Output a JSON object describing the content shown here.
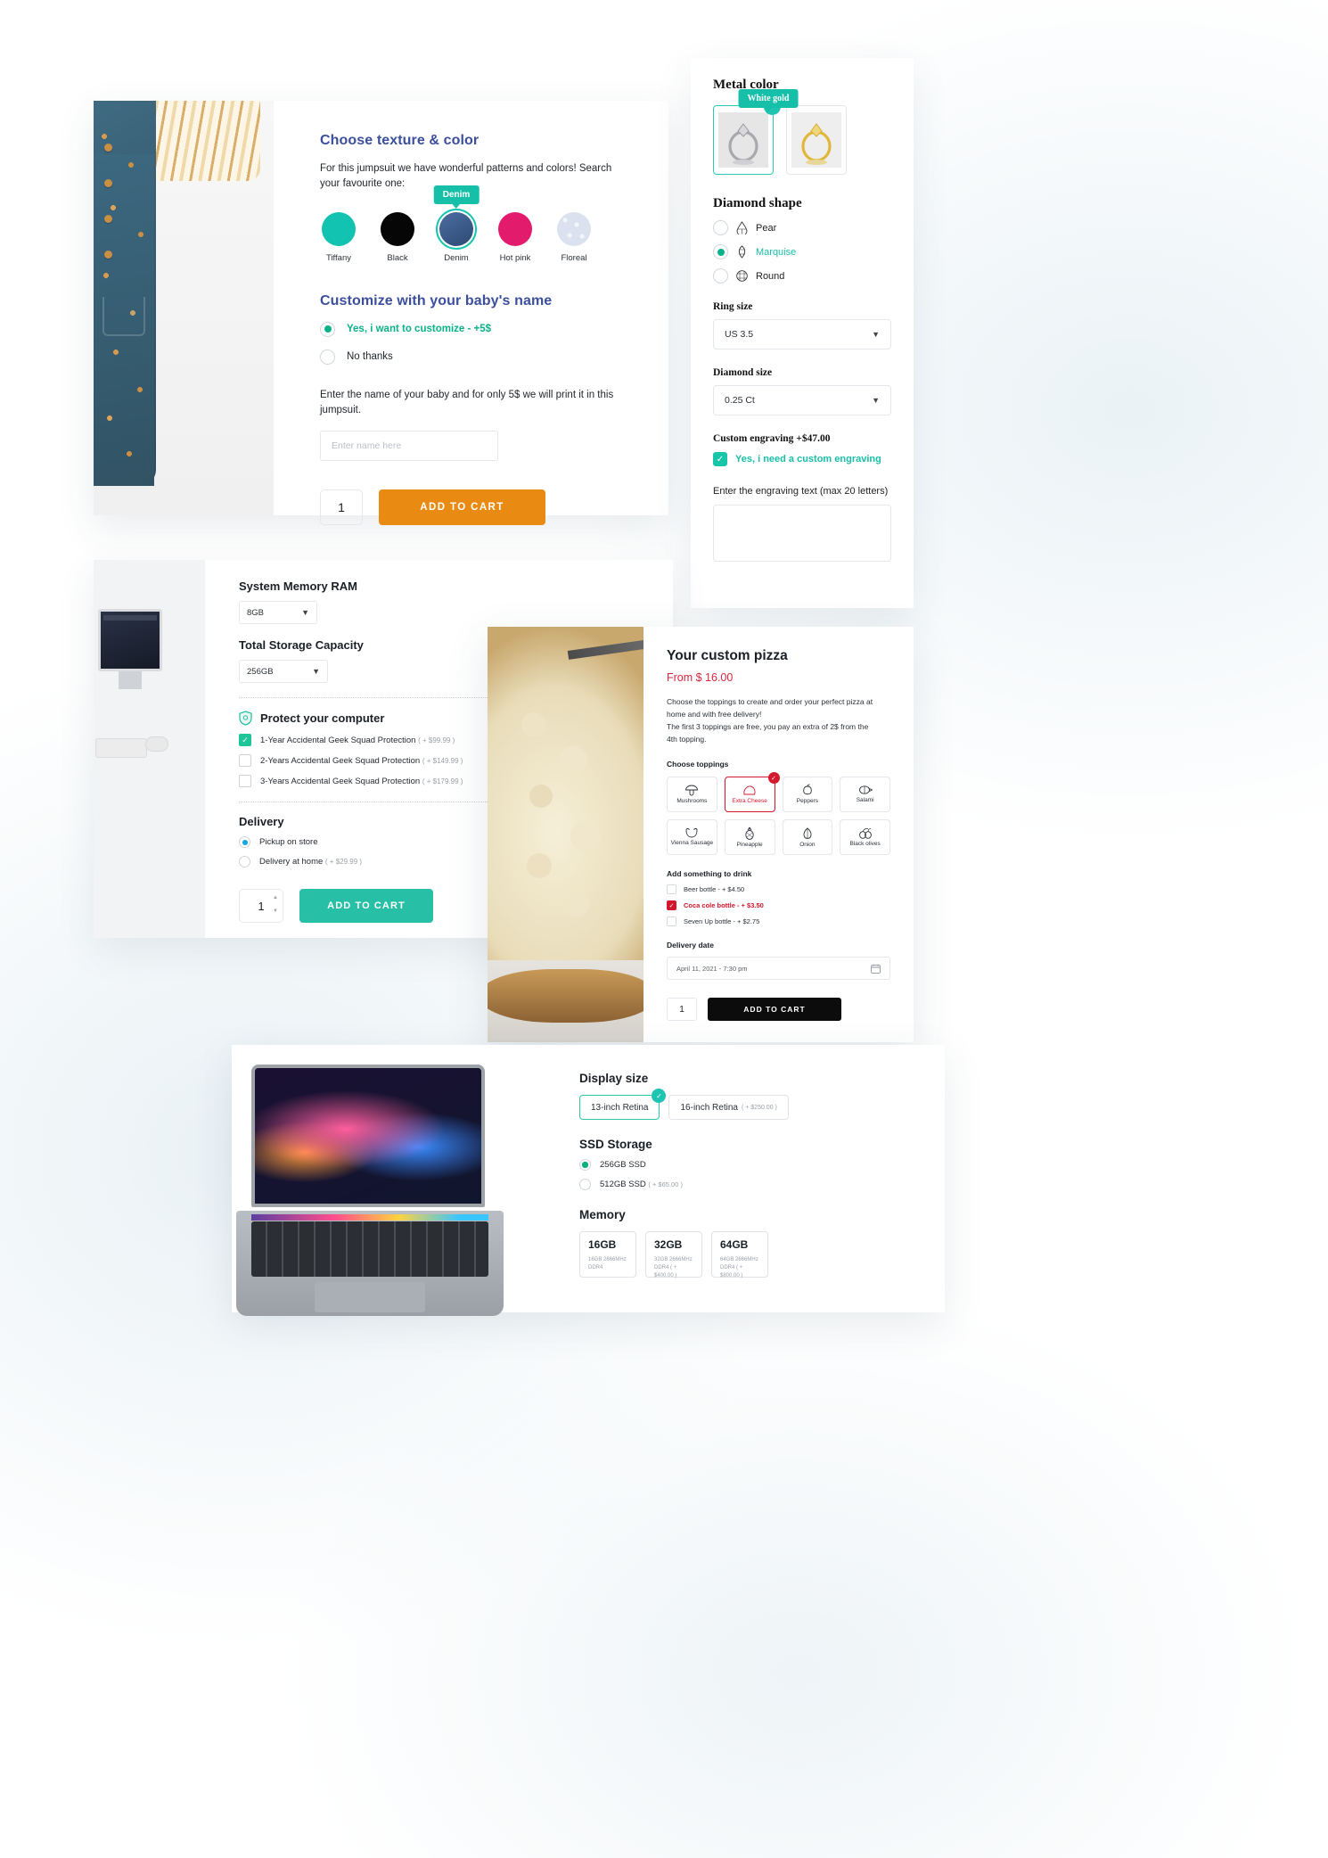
{
  "jumpsuit": {
    "heading_texture": "Choose texture & color",
    "desc": "For this jumpsuit we have wonderful patterns and colors! Search your favourite one:",
    "tooltip": "Denim",
    "swatches": [
      {
        "label": "Tiffany",
        "color": "#11c3b0",
        "selected": false
      },
      {
        "label": "Black",
        "color": "#060606",
        "selected": false
      },
      {
        "label": "Denim",
        "color": "#35537f",
        "selected": true
      },
      {
        "label": "Hot pink",
        "color": "#e31b6d",
        "selected": false
      },
      {
        "label": "Floreal",
        "color": "#dbe2ef",
        "selected": false
      }
    ],
    "heading_name": "Customize with your baby's name",
    "options": [
      {
        "label": "Yes, i want to customize - +5$",
        "selected": true
      },
      {
        "label": "No thanks",
        "selected": false
      }
    ],
    "name_desc": "Enter the name of your baby and for only 5$ we will print it in this jumpsuit.",
    "name_placeholder": "Enter name here",
    "quantity": "1",
    "add_to_cart": "ADD TO CART"
  },
  "ring": {
    "title": "Metal color",
    "tooltip": "White gold",
    "metals": [
      {
        "name": "White gold",
        "selected": true
      },
      {
        "name": "Yellow gold",
        "selected": false
      }
    ],
    "shape_heading": "Diamond shape",
    "shapes": [
      {
        "label": "Pear",
        "selected": false
      },
      {
        "label": "Marquise",
        "selected": true
      },
      {
        "label": "Round",
        "selected": false
      }
    ],
    "ring_size_label": "Ring size",
    "ring_size_value": "US 3.5",
    "diamond_size_label": "Diamond size",
    "diamond_size_value": "0.25 Ct",
    "engraving_heading": "Custom engraving +$47.00",
    "engraving_checkbox": "Yes, i need a custom engraving",
    "engraving_hint": "Enter the engraving text (max 20 letters)",
    "engraving_value": ""
  },
  "computer": {
    "ram_label": "System Memory RAM",
    "ram_value": "8GB",
    "storage_label": "Total Storage Capacity",
    "storage_value": "256GB",
    "protect_heading": "Protect your computer",
    "protect_options": [
      {
        "label": "1-Year Accidental Geek Squad Protection",
        "price": "( + $99.99 )",
        "checked": true
      },
      {
        "label": "2-Years Accidental Geek Squad Protection",
        "price": "( + $149.99 )",
        "checked": false
      },
      {
        "label": "3-Years Accidental Geek Squad Protection",
        "price": "( + $179.99 )",
        "checked": false
      }
    ],
    "delivery_heading": "Delivery",
    "delivery_options": [
      {
        "label": "Pickup on store",
        "price": "",
        "selected": true
      },
      {
        "label": "Delivery at home",
        "price": "( + $29.99 )",
        "selected": false
      }
    ],
    "quantity": "1",
    "add_to_cart": "ADD TO CART"
  },
  "pizza": {
    "title": "Your custom pizza",
    "price": "From $ 16.00",
    "desc_line1": "Choose the toppings to create and order your perfect pizza at",
    "desc_line2": "home and with free delivery!",
    "desc_line3": "The first 3 toppings are free, you pay an extra of 2$ from the",
    "desc_line4": "4th topping.",
    "toppings_heading": "Choose toppings",
    "toppings": [
      {
        "label": "Mushrooms",
        "icon": "☂",
        "selected": false
      },
      {
        "label": "Extra Cheese",
        "icon": "◔",
        "selected": true
      },
      {
        "label": "Peppers",
        "icon": "●",
        "selected": false
      },
      {
        "label": "Salami",
        "icon": "◑",
        "selected": false
      },
      {
        "label": "Vienna Sausage",
        "icon": "◝",
        "selected": false
      },
      {
        "label": "Pineapple",
        "icon": "⚘",
        "selected": false
      },
      {
        "label": "Onion",
        "icon": "◇",
        "selected": false
      },
      {
        "label": "Black olives",
        "icon": "⊚",
        "selected": false
      }
    ],
    "drinks_heading": "Add something to drink",
    "drinks": [
      {
        "label": "Beer bottle - + $4.50",
        "checked": false
      },
      {
        "label": "Coca cole bottle - + $3.50",
        "checked": true
      },
      {
        "label": "Seven Up bottle - + $2.75",
        "checked": false
      }
    ],
    "date_heading": "Delivery date",
    "date_value": "April 11, 2021 - 7:30 pm",
    "quantity": "1",
    "add_to_cart": "ADD TO CART"
  },
  "laptop": {
    "display_heading": "Display size",
    "display_options": [
      {
        "label": "13-inch Retina",
        "price": "",
        "selected": true
      },
      {
        "label": "16-inch Retina",
        "price": "( + $250.00 )",
        "selected": false
      }
    ],
    "ssd_heading": "SSD Storage",
    "ssd_options": [
      {
        "label": "256GB SSD",
        "price": "",
        "selected": true
      },
      {
        "label": "512GB SSD",
        "price": "( + $65.00 )",
        "selected": false
      }
    ],
    "memory_heading": "Memory",
    "memory_options": [
      {
        "size": "16GB",
        "detail": "16GB 2666MHz DDR4"
      },
      {
        "size": "32GB",
        "detail": "32GB 2666MHz DDR4 ( + $400.00 )"
      },
      {
        "size": "64GB",
        "detail": "64GB 2666MHz DDR4 ( + $800.00 )"
      }
    ]
  },
  "colors": {
    "teal": "#19bfa7",
    "orange": "#e98a12",
    "red": "#d3172c",
    "blue_heading": "#3b4f9c"
  }
}
